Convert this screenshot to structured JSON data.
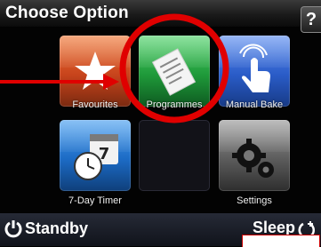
{
  "header": {
    "title": "Choose Option",
    "help_label": "?"
  },
  "tiles": [
    {
      "label": "Favourites",
      "icon": "star-icon",
      "color": "#d7562a"
    },
    {
      "label": "Programmes",
      "icon": "document-icon",
      "color": "#25a244"
    },
    {
      "label": "Manual Bake",
      "icon": "hand-pointer-icon",
      "color": "#2b5fc9"
    },
    {
      "label": "7-Day Timer",
      "icon": "clock-calendar-icon",
      "color": "#2c7fd9"
    },
    {
      "label": "",
      "icon": "",
      "color": "#141420"
    },
    {
      "label": "Settings",
      "icon": "gears-icon",
      "color": "#707070"
    }
  ],
  "footer": {
    "standby_label": "Standby",
    "sleep_label": "Sleep"
  },
  "annotation": {
    "highlight_color": "#e00000"
  }
}
